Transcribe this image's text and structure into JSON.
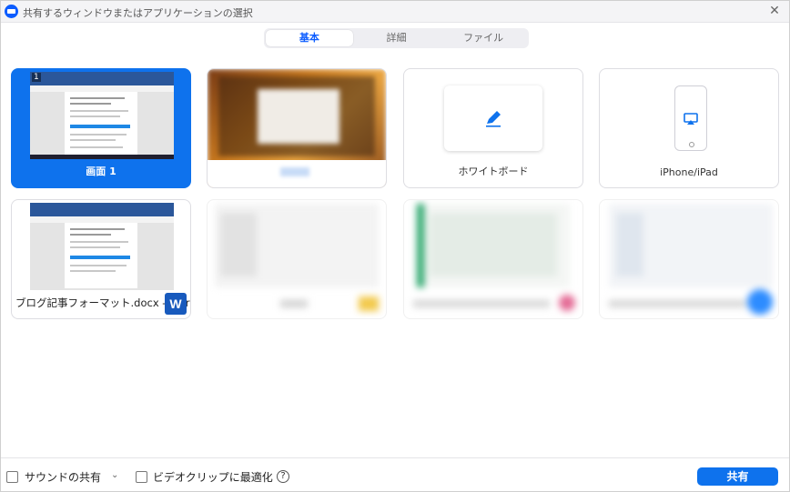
{
  "window": {
    "title": "共有するウィンドウまたはアプリケーションの選択"
  },
  "tabs": [
    {
      "label": "基本",
      "active": true
    },
    {
      "label": "詳細",
      "active": false
    },
    {
      "label": "ファイル",
      "active": false
    }
  ],
  "tiles": {
    "screen1": {
      "label": "画面 1",
      "badge": "1"
    },
    "whiteboard": {
      "label": "ホワイトボード"
    },
    "iphone": {
      "label": "iPhone/iPad"
    },
    "word_window": {
      "label": "ブログ記事フォーマット.docx - Word",
      "icon_letter": "W"
    }
  },
  "footer": {
    "sound_label": "サウンドの共有",
    "video_label": "ビデオクリップに最適化",
    "help_symbol": "?",
    "share_label": "共有"
  },
  "colors": {
    "accent": "#0e72ed",
    "brand": "#0b5cff",
    "word_blue": "#185abd"
  },
  "icons": [
    "app-logo-icon",
    "close-icon",
    "whiteboard-pen-icon",
    "airplay-icon",
    "word-app-icon",
    "chevron-down-icon",
    "help-icon"
  ]
}
